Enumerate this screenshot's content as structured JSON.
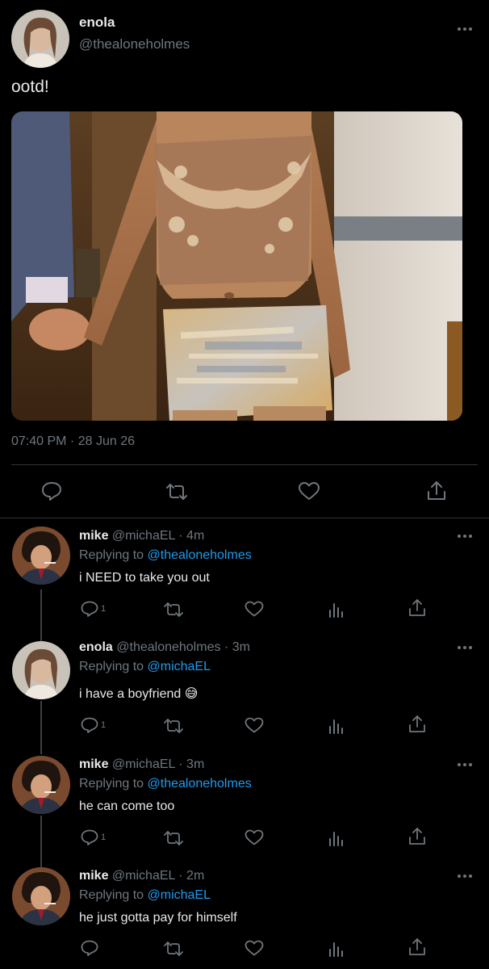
{
  "main_tweet": {
    "author_name": "enola",
    "author_handle": "@thealoneholmes",
    "text": "ootd!",
    "timestamp": "07:40 PM · 28 Jun 26",
    "more_icon": "more-horizontal-icon",
    "actions": [
      {
        "icon": "reply-icon"
      },
      {
        "icon": "retweet-icon"
      },
      {
        "icon": "like-icon"
      },
      {
        "icon": "share-icon"
      }
    ]
  },
  "replies": [
    {
      "author_name": "mike",
      "author_handle": "@michaEL",
      "time": "· 4m",
      "replying_to_label": "Replying to",
      "replying_to_handle": "@thealoneholmes",
      "text": "i NEED to take you out",
      "reply_count": "1"
    },
    {
      "author_name": "enola",
      "author_handle": "@thealoneholmes",
      "time": "· 3m",
      "replying_to_label": "Replying to",
      "replying_to_handle": "@michaEL",
      "text": "i have a boyfriend 😅",
      "reply_count": "1"
    },
    {
      "author_name": "mike",
      "author_handle": "@michaEL",
      "time": "· 3m",
      "replying_to_label": "Replying to",
      "replying_to_handle": "@thealoneholmes",
      "text": "he can come too",
      "reply_count": "1"
    },
    {
      "author_name": "mike",
      "author_handle": "@michaEL",
      "time": "· 2m",
      "replying_to_label": "Replying to",
      "replying_to_handle": "@michaEL",
      "text": "he just gotta pay for himself",
      "reply_count": ""
    }
  ],
  "colors": {
    "background": "#000000",
    "text": "#e7e9ea",
    "muted": "#6e767d",
    "link": "#1d9bf0",
    "divider": "#2f3336"
  }
}
